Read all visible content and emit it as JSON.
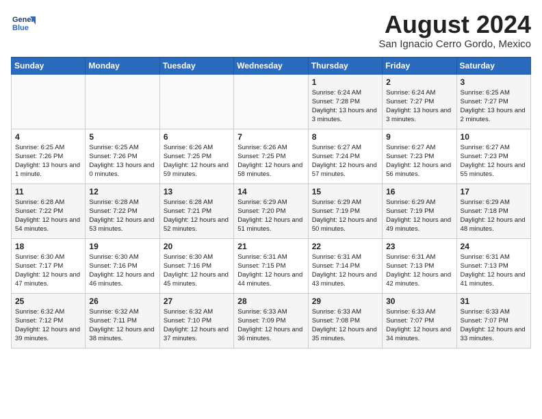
{
  "header": {
    "logo_line1": "General",
    "logo_line2": "Blue",
    "title": "August 2024",
    "subtitle": "San Ignacio Cerro Gordo, Mexico"
  },
  "calendar": {
    "days_of_week": [
      "Sunday",
      "Monday",
      "Tuesday",
      "Wednesday",
      "Thursday",
      "Friday",
      "Saturday"
    ],
    "weeks": [
      [
        {
          "day": "",
          "info": ""
        },
        {
          "day": "",
          "info": ""
        },
        {
          "day": "",
          "info": ""
        },
        {
          "day": "",
          "info": ""
        },
        {
          "day": "1",
          "info": "Sunrise: 6:24 AM\nSunset: 7:28 PM\nDaylight: 13 hours\nand 3 minutes."
        },
        {
          "day": "2",
          "info": "Sunrise: 6:24 AM\nSunset: 7:27 PM\nDaylight: 13 hours\nand 3 minutes."
        },
        {
          "day": "3",
          "info": "Sunrise: 6:25 AM\nSunset: 7:27 PM\nDaylight: 13 hours\nand 2 minutes."
        }
      ],
      [
        {
          "day": "4",
          "info": "Sunrise: 6:25 AM\nSunset: 7:26 PM\nDaylight: 13 hours\nand 1 minute."
        },
        {
          "day": "5",
          "info": "Sunrise: 6:25 AM\nSunset: 7:26 PM\nDaylight: 13 hours\nand 0 minutes."
        },
        {
          "day": "6",
          "info": "Sunrise: 6:26 AM\nSunset: 7:25 PM\nDaylight: 12 hours\nand 59 minutes."
        },
        {
          "day": "7",
          "info": "Sunrise: 6:26 AM\nSunset: 7:25 PM\nDaylight: 12 hours\nand 58 minutes."
        },
        {
          "day": "8",
          "info": "Sunrise: 6:27 AM\nSunset: 7:24 PM\nDaylight: 12 hours\nand 57 minutes."
        },
        {
          "day": "9",
          "info": "Sunrise: 6:27 AM\nSunset: 7:23 PM\nDaylight: 12 hours\nand 56 minutes."
        },
        {
          "day": "10",
          "info": "Sunrise: 6:27 AM\nSunset: 7:23 PM\nDaylight: 12 hours\nand 55 minutes."
        }
      ],
      [
        {
          "day": "11",
          "info": "Sunrise: 6:28 AM\nSunset: 7:22 PM\nDaylight: 12 hours\nand 54 minutes."
        },
        {
          "day": "12",
          "info": "Sunrise: 6:28 AM\nSunset: 7:22 PM\nDaylight: 12 hours\nand 53 minutes."
        },
        {
          "day": "13",
          "info": "Sunrise: 6:28 AM\nSunset: 7:21 PM\nDaylight: 12 hours\nand 52 minutes."
        },
        {
          "day": "14",
          "info": "Sunrise: 6:29 AM\nSunset: 7:20 PM\nDaylight: 12 hours\nand 51 minutes."
        },
        {
          "day": "15",
          "info": "Sunrise: 6:29 AM\nSunset: 7:19 PM\nDaylight: 12 hours\nand 50 minutes."
        },
        {
          "day": "16",
          "info": "Sunrise: 6:29 AM\nSunset: 7:19 PM\nDaylight: 12 hours\nand 49 minutes."
        },
        {
          "day": "17",
          "info": "Sunrise: 6:29 AM\nSunset: 7:18 PM\nDaylight: 12 hours\nand 48 minutes."
        }
      ],
      [
        {
          "day": "18",
          "info": "Sunrise: 6:30 AM\nSunset: 7:17 PM\nDaylight: 12 hours\nand 47 minutes."
        },
        {
          "day": "19",
          "info": "Sunrise: 6:30 AM\nSunset: 7:16 PM\nDaylight: 12 hours\nand 46 minutes."
        },
        {
          "day": "20",
          "info": "Sunrise: 6:30 AM\nSunset: 7:16 PM\nDaylight: 12 hours\nand 45 minutes."
        },
        {
          "day": "21",
          "info": "Sunrise: 6:31 AM\nSunset: 7:15 PM\nDaylight: 12 hours\nand 44 minutes."
        },
        {
          "day": "22",
          "info": "Sunrise: 6:31 AM\nSunset: 7:14 PM\nDaylight: 12 hours\nand 43 minutes."
        },
        {
          "day": "23",
          "info": "Sunrise: 6:31 AM\nSunset: 7:13 PM\nDaylight: 12 hours\nand 42 minutes."
        },
        {
          "day": "24",
          "info": "Sunrise: 6:31 AM\nSunset: 7:13 PM\nDaylight: 12 hours\nand 41 minutes."
        }
      ],
      [
        {
          "day": "25",
          "info": "Sunrise: 6:32 AM\nSunset: 7:12 PM\nDaylight: 12 hours\nand 39 minutes."
        },
        {
          "day": "26",
          "info": "Sunrise: 6:32 AM\nSunset: 7:11 PM\nDaylight: 12 hours\nand 38 minutes."
        },
        {
          "day": "27",
          "info": "Sunrise: 6:32 AM\nSunset: 7:10 PM\nDaylight: 12 hours\nand 37 minutes."
        },
        {
          "day": "28",
          "info": "Sunrise: 6:33 AM\nSunset: 7:09 PM\nDaylight: 12 hours\nand 36 minutes."
        },
        {
          "day": "29",
          "info": "Sunrise: 6:33 AM\nSunset: 7:08 PM\nDaylight: 12 hours\nand 35 minutes."
        },
        {
          "day": "30",
          "info": "Sunrise: 6:33 AM\nSunset: 7:07 PM\nDaylight: 12 hours\nand 34 minutes."
        },
        {
          "day": "31",
          "info": "Sunrise: 6:33 AM\nSunset: 7:07 PM\nDaylight: 12 hours\nand 33 minutes."
        }
      ]
    ]
  }
}
